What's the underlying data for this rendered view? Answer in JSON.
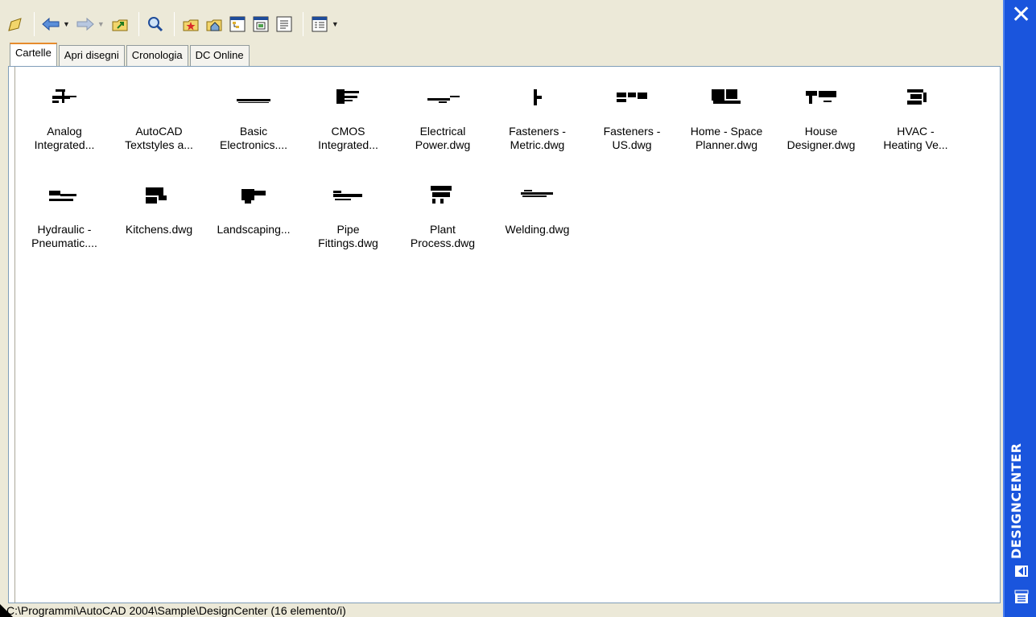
{
  "toolbar": {
    "buttons": [
      "load-icon",
      "back-icon",
      "forward-icon",
      "up-icon",
      "search-icon",
      "favorites-icon",
      "home-icon",
      "tree-view-icon",
      "preview-icon",
      "description-icon",
      "views-icon"
    ]
  },
  "tabs": [
    {
      "label": "Cartelle",
      "active": true
    },
    {
      "label": "Apri disegni",
      "active": false
    },
    {
      "label": "Cronologia",
      "active": false
    },
    {
      "label": "DC Online",
      "active": false
    }
  ],
  "items": [
    {
      "label": "Analog\nIntegrated..."
    },
    {
      "label": "AutoCAD\nTextstyles a..."
    },
    {
      "label": "Basic\nElectronics...."
    },
    {
      "label": "CMOS\nIntegrated..."
    },
    {
      "label": "Electrical\nPower.dwg"
    },
    {
      "label": "Fasteners -\nMetric.dwg"
    },
    {
      "label": "Fasteners -\nUS.dwg"
    },
    {
      "label": "Home - Space\nPlanner.dwg"
    },
    {
      "label": "House\nDesigner.dwg"
    },
    {
      "label": "HVAC -\nHeating Ve..."
    },
    {
      "label": "Hydraulic -\nPneumatic...."
    },
    {
      "label": "Kitchens.dwg"
    },
    {
      "label": "Landscaping..."
    },
    {
      "label": "Pipe\nFittings.dwg"
    },
    {
      "label": "Plant\nProcess.dwg"
    },
    {
      "label": "Welding.dwg"
    }
  ],
  "status": {
    "text": "C:\\Programmi\\AutoCAD 2004\\Sample\\DesignCenter (16 elemento/i)"
  },
  "sidebar": {
    "title": "DESIGNCENTER",
    "close_label": "✕",
    "accent": "#1a55dd"
  }
}
